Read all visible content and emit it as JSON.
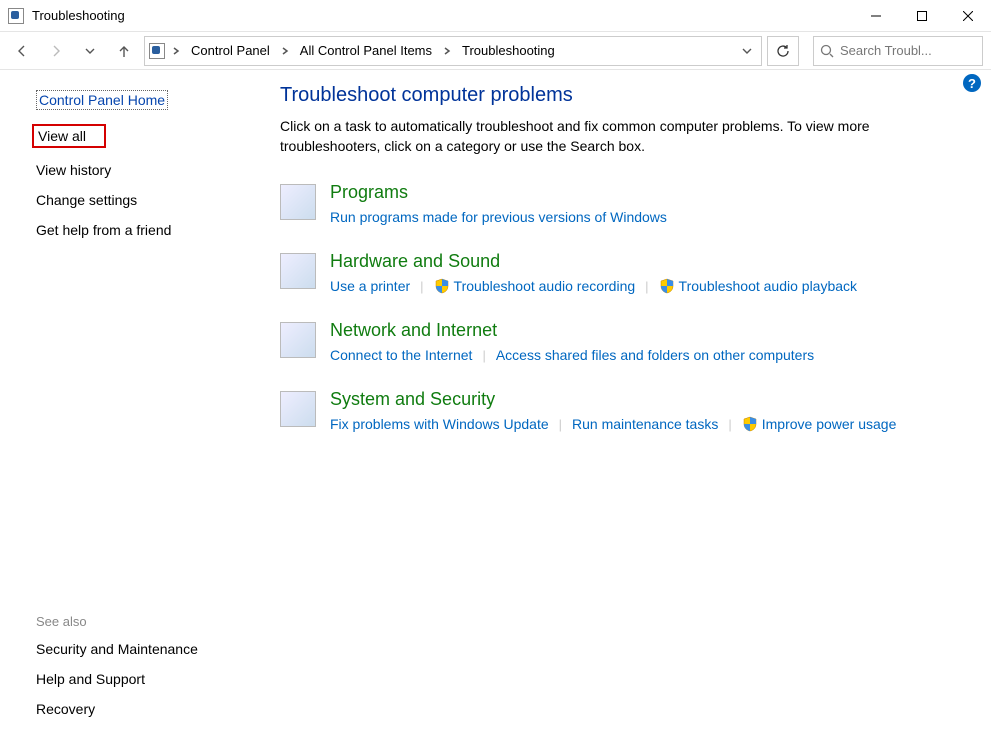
{
  "window": {
    "title": "Troubleshooting"
  },
  "breadcrumb": {
    "items": [
      "Control Panel",
      "All Control Panel Items",
      "Troubleshooting"
    ]
  },
  "search": {
    "placeholder": "Search Troubl..."
  },
  "sidebar": {
    "home": "Control Panel Home",
    "links": [
      "View all",
      "View history",
      "Change settings",
      "Get help from a friend"
    ],
    "see_also_header": "See also",
    "see_also": [
      "Security and Maintenance",
      "Help and Support",
      "Recovery"
    ]
  },
  "page": {
    "title": "Troubleshoot computer problems",
    "description": "Click on a task to automatically troubleshoot and fix common computer problems. To view more troubleshooters, click on a category or use the Search box."
  },
  "categories": [
    {
      "title": "Programs",
      "links": [
        {
          "label": "Run programs made for previous versions of Windows",
          "shield": false
        }
      ]
    },
    {
      "title": "Hardware and Sound",
      "links": [
        {
          "label": "Use a printer",
          "shield": false
        },
        {
          "label": "Troubleshoot audio recording",
          "shield": true
        },
        {
          "label": "Troubleshoot audio playback",
          "shield": true
        }
      ]
    },
    {
      "title": "Network and Internet",
      "links": [
        {
          "label": "Connect to the Internet",
          "shield": false
        },
        {
          "label": "Access shared files and folders on other computers",
          "shield": false
        }
      ]
    },
    {
      "title": "System and Security",
      "links": [
        {
          "label": "Fix problems with Windows Update",
          "shield": false
        },
        {
          "label": "Run maintenance tasks",
          "shield": false
        },
        {
          "label": "Improve power usage",
          "shield": true
        }
      ]
    }
  ]
}
